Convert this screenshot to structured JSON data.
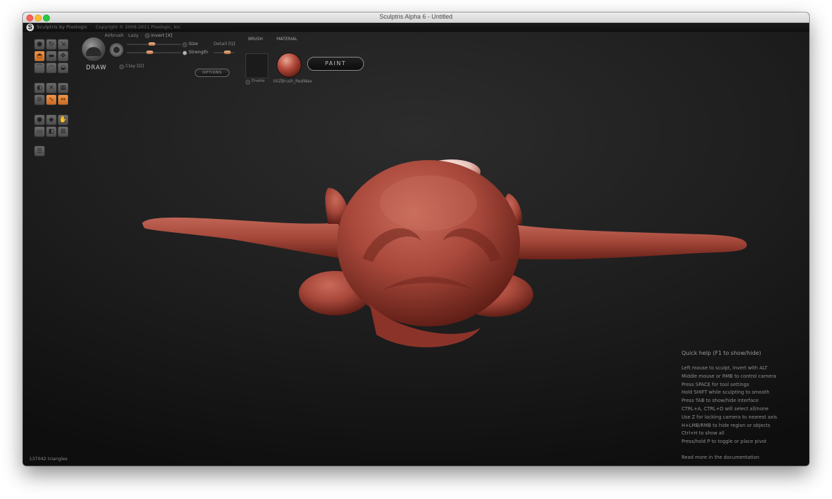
{
  "window": {
    "title": "Sculptris Alpha 6 - Untitled",
    "brand": "Sculptris by Pixologic",
    "copyright": "Copyright © 2009-2011 Pixologic, Inc."
  },
  "toolbar": {
    "tool_name": "DRAW",
    "airbrush_label": "Airbrush",
    "lazy_label": "Lazy",
    "invert_label": "Invert [X]",
    "size_label": "Size",
    "detail_label": "Detail [Q]",
    "strength_label": "Strength",
    "clay_label": "Clay [D]",
    "options_label": "OPTIONS",
    "brush_header": "BRUSH",
    "enable_label": "Enable",
    "material_header": "MATERIAL",
    "material_name": "00ZBrush_RedWax",
    "paint_label": "PAINT",
    "size_level": 0.45,
    "strength_level": 0.35
  },
  "tools": [
    {
      "icon": "sphere-icon",
      "active": false
    },
    {
      "icon": "rotate-icon",
      "active": false
    },
    {
      "icon": "scale-icon",
      "active": false
    },
    {
      "icon": "draw-icon",
      "active": true
    },
    {
      "icon": "flatten-icon",
      "active": false
    },
    {
      "icon": "move-icon",
      "active": false
    },
    {
      "icon": "crease-icon",
      "active": false
    },
    {
      "icon": "inflate-icon",
      "active": false
    },
    {
      "icon": "smooth-icon",
      "active": false
    },
    {
      "icon": "symmetry-icon",
      "active": false
    },
    {
      "icon": "wireframe-icon",
      "active": false
    },
    {
      "icon": "grid-icon",
      "active": false
    },
    {
      "icon": "reduce-icon",
      "active": false
    },
    {
      "icon": "subdivide-icon",
      "active": true
    },
    {
      "icon": "mirror-icon",
      "active": true
    },
    {
      "icon": "mask-icon",
      "active": false
    },
    {
      "icon": "pinch-icon",
      "active": false
    },
    {
      "icon": "grab-icon",
      "active": false
    },
    {
      "icon": "lower-icon",
      "active": false
    },
    {
      "icon": "hide-icon",
      "active": false
    },
    {
      "icon": "merge-icon",
      "active": false
    },
    {
      "icon": "menu-icon",
      "active": false
    }
  ],
  "colors": {
    "accent": "#e07a30",
    "material": "#b44a3d",
    "background": "#1d1d1d"
  },
  "help": {
    "title": "Quick help (F1 to show/hide)",
    "lines": [
      "Left mouse to sculpt, invert with ALT",
      "Middle mouse or RMB to control camera",
      "Press SPACE for tool settings",
      "Hold SHIFT while sculpting to smooth",
      "Press TAB to show/hide interface",
      "CTRL+A, CTRL+D will select all/none",
      "Use Z for locking camera to nearest axis",
      "H+LMB/RMB to hide region or objects",
      "Ctrl+H to show all",
      "Press/hold P to toggle or place pivot"
    ],
    "more": "Read more in the documentation"
  },
  "status": {
    "triangles": "137042 triangles"
  }
}
